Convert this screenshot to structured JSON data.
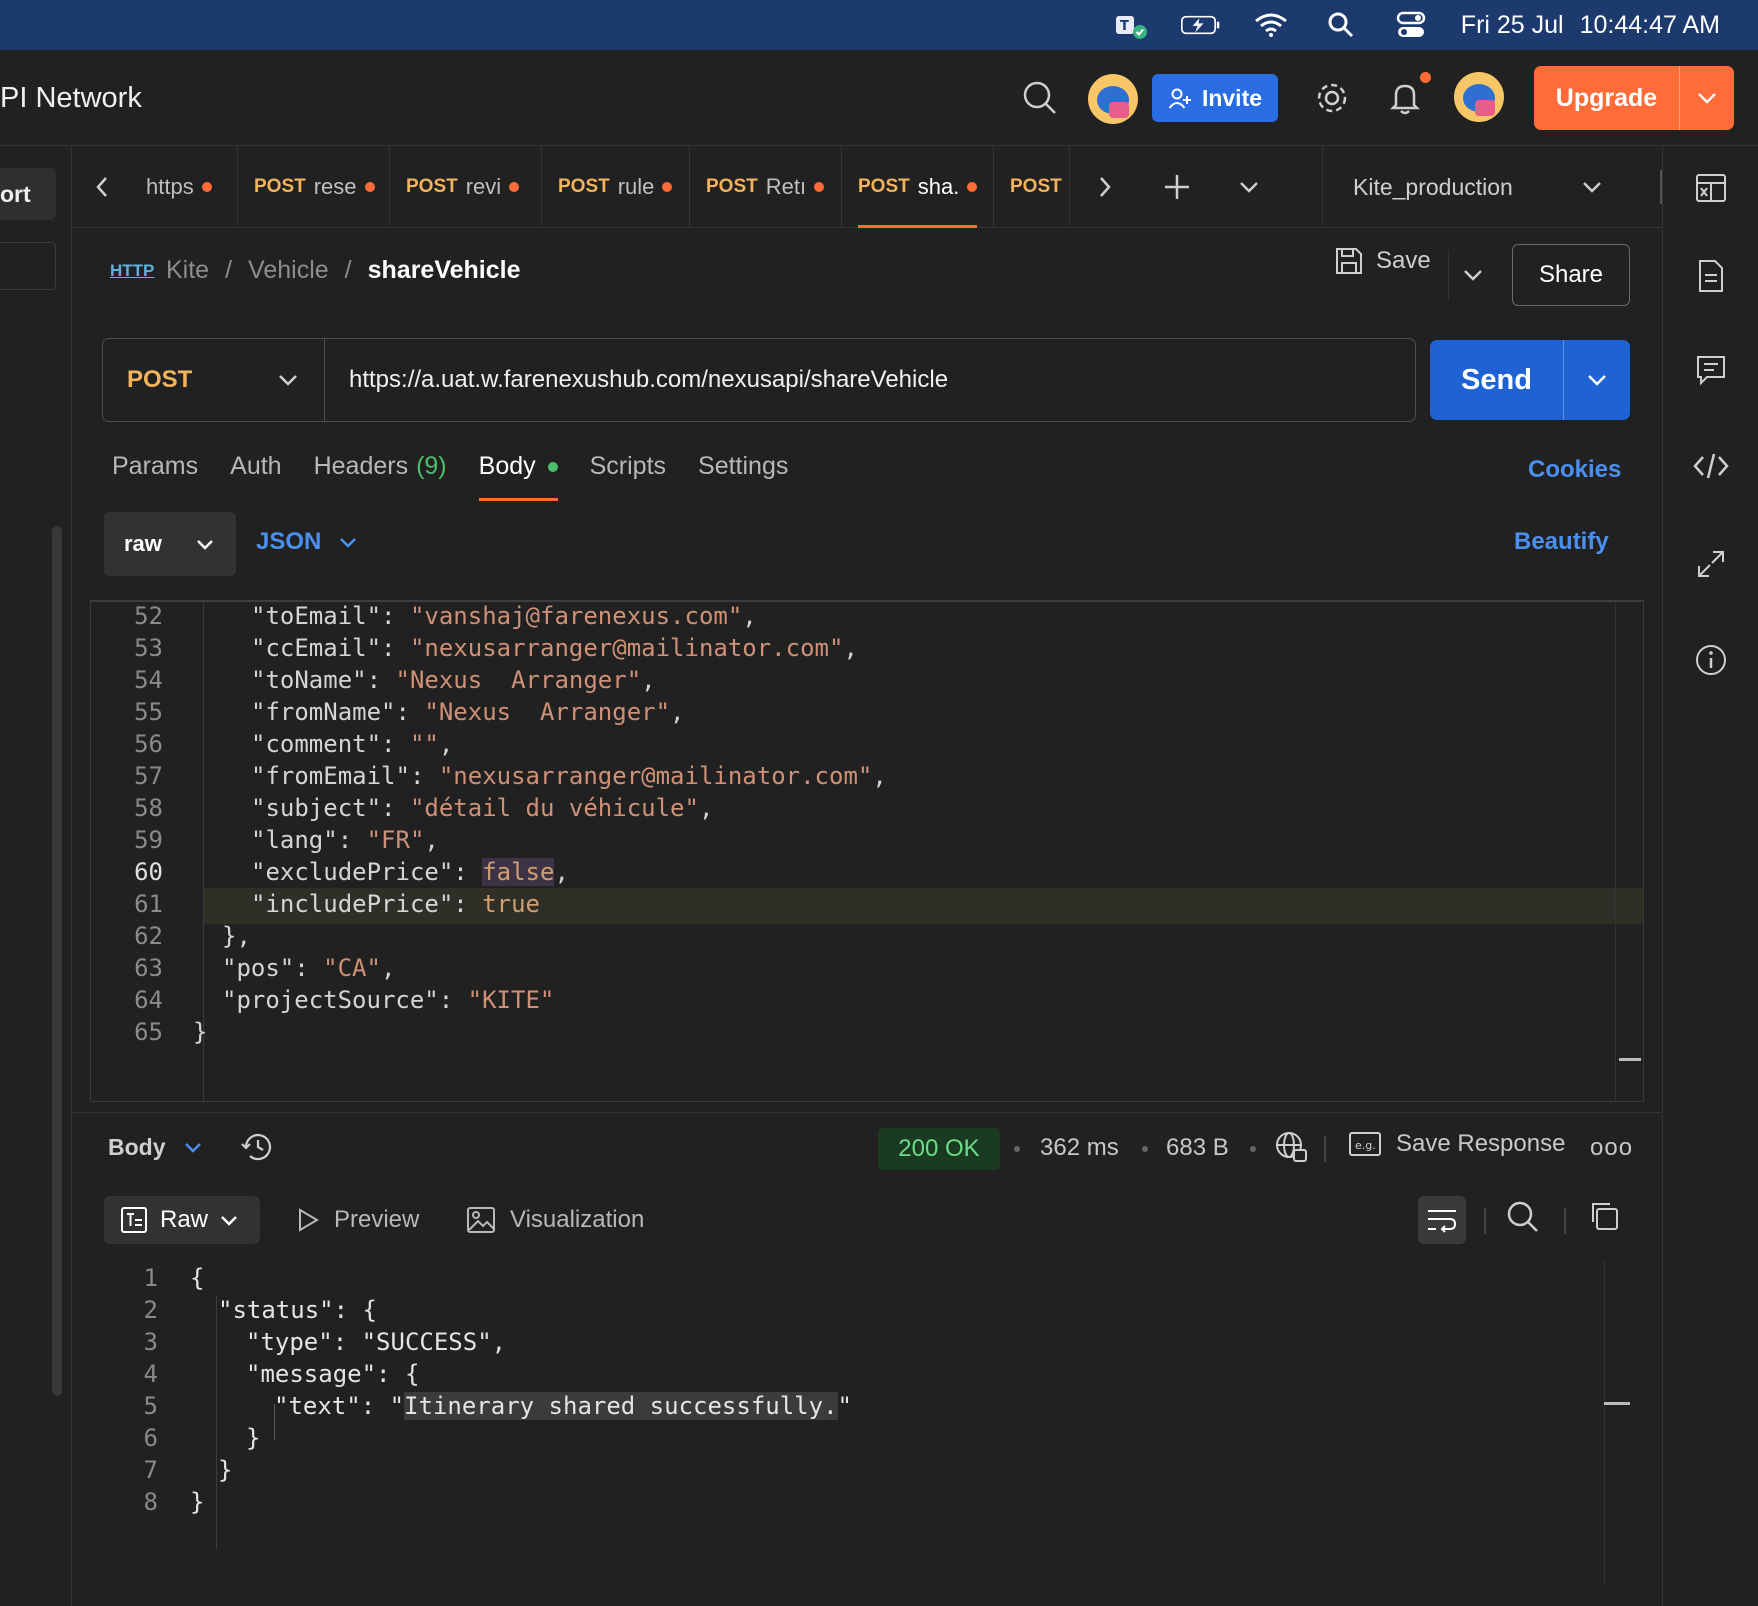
{
  "menubar": {
    "date": "Fri 25 Jul",
    "time": "10:44:47 AM",
    "icons": [
      "teams-icon",
      "battery-charging-icon",
      "wifi-icon",
      "spotlight-search-icon",
      "control-center-icon"
    ]
  },
  "app": {
    "title": "PI Network",
    "invite_label": "Invite",
    "upgrade_label": "Upgrade",
    "accent": "#ff6c37"
  },
  "leftrail": {
    "port_label": "ort"
  },
  "tabs": [
    {
      "method": "",
      "name": "https",
      "dirty": true
    },
    {
      "method": "POST",
      "name": "rese",
      "dirty": true
    },
    {
      "method": "POST",
      "name": "revi",
      "dirty": true
    },
    {
      "method": "POST",
      "name": "rule",
      "dirty": true
    },
    {
      "method": "POST",
      "name": "Retı",
      "dirty": true
    },
    {
      "method": "POST",
      "name": "sha.",
      "dirty": true,
      "active": true
    },
    {
      "method": "POST",
      "name": "(",
      "dirty": false
    }
  ],
  "environment": "Kite_production",
  "breadcrumb": {
    "badge": "HTTP",
    "collection": "Kite",
    "folder": "Vehicle",
    "sep": "/",
    "request": "shareVehicle"
  },
  "actions": {
    "save_label": "Save",
    "share_label": "Share"
  },
  "request": {
    "method": "POST",
    "url": "https://a.uat.w.farenexushub.com/nexusapi/shareVehicle",
    "send_label": "Send",
    "tabs": [
      {
        "label": "Params"
      },
      {
        "label": "Auth"
      },
      {
        "label": "Headers",
        "count": "(9)"
      },
      {
        "label": "Body",
        "active": true
      },
      {
        "label": "Scripts"
      },
      {
        "label": "Settings"
      }
    ],
    "cookies_label": "Cookies",
    "body_mode": "raw",
    "body_lang": "JSON",
    "beautify_label": "Beautify"
  },
  "request_body": [
    {
      "n": "52",
      "indent": 2,
      "key": "\"toEmail\"",
      "sep": ": ",
      "val": "\"vanshaj@farenexus.com\"",
      "vt": "s",
      "end": ","
    },
    {
      "n": "53",
      "indent": 2,
      "key": "\"ccEmail\"",
      "sep": ": ",
      "val": "\"nexusarranger@mailinator.com\"",
      "vt": "s",
      "end": ","
    },
    {
      "n": "54",
      "indent": 2,
      "key": "\"toName\"",
      "sep": ": ",
      "val": "\"Nexus  Arranger\"",
      "vt": "s",
      "end": ","
    },
    {
      "n": "55",
      "indent": 2,
      "key": "\"fromName\"",
      "sep": ": ",
      "val": "\"Nexus  Arranger\"",
      "vt": "s",
      "end": ","
    },
    {
      "n": "56",
      "indent": 2,
      "key": "\"comment\"",
      "sep": ": ",
      "val": "\"\"",
      "vt": "s",
      "end": ","
    },
    {
      "n": "57",
      "indent": 2,
      "key": "\"fromEmail\"",
      "sep": ": ",
      "val": "\"nexusarranger@mailinator.com\"",
      "vt": "s",
      "end": ","
    },
    {
      "n": "58",
      "indent": 2,
      "key": "\"subject\"",
      "sep": ": ",
      "val": "\"détail du véhicule\"",
      "vt": "s",
      "end": ","
    },
    {
      "n": "59",
      "indent": 2,
      "key": "\"lang\"",
      "sep": ": ",
      "val": "\"FR\"",
      "vt": "s",
      "end": ","
    },
    {
      "n": "60",
      "indent": 2,
      "key": "\"excludePrice\"",
      "sep": ": ",
      "val": "false",
      "vt": "b",
      "end": ",",
      "highlight": true
    },
    {
      "n": "61",
      "indent": 2,
      "key": "\"includePrice\"",
      "sep": ": ",
      "val": "true",
      "vt": "b",
      "end": ""
    },
    {
      "n": "62",
      "indent": 1,
      "key": "}",
      "sep": "",
      "val": "",
      "vt": "p",
      "end": ","
    },
    {
      "n": "63",
      "indent": 1,
      "key": "\"pos\"",
      "sep": ": ",
      "val": "\"CA\"",
      "vt": "s",
      "end": ","
    },
    {
      "n": "64",
      "indent": 1,
      "key": "\"projectSource\"",
      "sep": ": ",
      "val": "\"KITE\"",
      "vt": "s",
      "end": ""
    },
    {
      "n": "65",
      "indent": 0,
      "key": "}",
      "sep": "",
      "val": "",
      "vt": "p",
      "end": ""
    }
  ],
  "response": {
    "body_label": "Body",
    "status": "200 OK",
    "time": "362 ms",
    "size": "683 B",
    "save_response_label": "Save Response",
    "more_label": "ooo",
    "view_modes": {
      "raw": "Raw",
      "preview": "Preview",
      "visualization": "Visualization"
    },
    "status_color": "#6bdc86"
  },
  "response_body": [
    {
      "n": "1",
      "indent": 0,
      "text": "{"
    },
    {
      "n": "2",
      "indent": 1,
      "text": "\"status\": {"
    },
    {
      "n": "3",
      "indent": 2,
      "text": "\"type\": \"SUCCESS\","
    },
    {
      "n": "4",
      "indent": 2,
      "text": "\"message\": {"
    },
    {
      "n": "5",
      "indent": 3,
      "text": "\"text\": \"",
      "sel": "Itinerary shared successfully.",
      "after": "\""
    },
    {
      "n": "6",
      "indent": 2,
      "text": "}"
    },
    {
      "n": "7",
      "indent": 1,
      "text": "}"
    },
    {
      "n": "8",
      "indent": 0,
      "text": "}"
    }
  ]
}
